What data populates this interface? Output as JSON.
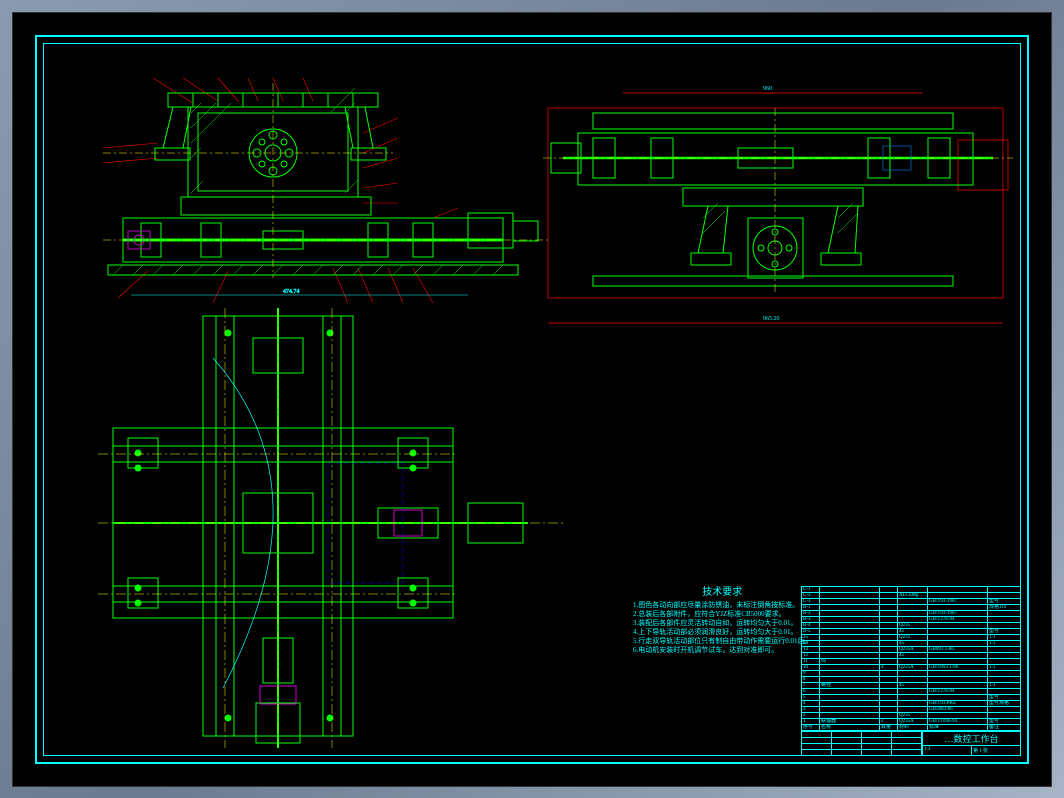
{
  "drawing": {
    "title": "…数控工作台",
    "scale": "1:2",
    "sheet": "第 1 张"
  },
  "notes": {
    "title": "技术要求",
    "lines": [
      "1.图色各动向部应尽量涂防锈油，未标注倒角按标准。",
      "2.总装后各部附件，应符合YJZ标准CB5000要求。",
      "3.装配后各部件应灵活转动自如，运转均匀大于0.01。",
      "4.上下导轨活动部必须润滑良好，运转均匀大于0.01。",
      "5.行走双导轨活动部位只有制自由带动作需要运行0.01后。",
      "6.电动机安装时开机调节试车，达到对准即可。"
    ]
  },
  "bom": {
    "header": [
      "序号",
      "名称",
      "数量",
      "材料",
      "标准",
      "备注"
    ],
    "rows": [
      [
        "C-1",
        "",
        "",
        "",
        "",
        ""
      ],
      [
        "C-2",
        "",
        "",
        "ALCuMg",
        "",
        ""
      ],
      [
        "C-3",
        "",
        "",
        "",
        "GB/T93-1987",
        "型号"
      ],
      [
        "B-1",
        "",
        "",
        "",
        "",
        "规格110"
      ],
      [
        "B-2",
        "",
        "",
        "",
        "GB/T93-1987",
        ""
      ],
      [
        "B-3",
        "",
        "",
        "",
        "GB/T276-94",
        ""
      ],
      [
        "B-4",
        "",
        "",
        "Q235",
        "",
        ""
      ],
      [
        "B-5",
        "",
        "",
        "45",
        "",
        "型号"
      ],
      [
        "15",
        "",
        "",
        "Q235",
        "",
        "1:1"
      ],
      [
        "14",
        "",
        "",
        "45",
        "",
        "1:1"
      ],
      [
        "13",
        "",
        "",
        "Q235A",
        "GB893.1-86",
        ""
      ],
      [
        "12",
        "",
        "",
        "45",
        "",
        ""
      ],
      [
        "11",
        "伺",
        "",
        "",
        "",
        ""
      ],
      [
        "10",
        "",
        "4",
        "Q235A",
        "GB/T893.1-86",
        "1:1"
      ],
      [
        "9",
        "",
        "",
        "",
        "",
        ""
      ],
      [
        "8",
        "",
        "",
        "",
        "",
        ""
      ],
      [
        "7",
        "螺栓",
        "",
        "45",
        "",
        "1:1"
      ],
      [
        "6",
        "",
        "",
        "",
        "GB/T276-94",
        ""
      ],
      [
        "5",
        "",
        "",
        "",
        "",
        "型号"
      ],
      [
        "4",
        "",
        "",
        "",
        "GB/T93.PKE",
        "型号规格"
      ],
      [
        "3",
        "",
        "",
        "",
        "GB5803-86",
        ""
      ],
      [
        "2",
        "",
        "",
        "Q235",
        "",
        ""
      ],
      [
        "1",
        "联轴器",
        "2",
        "Q235A",
        "GB/T1096-94",
        "型号"
      ]
    ]
  },
  "dimensions": {
    "top_right_width": "960",
    "bottom_span": "965.20"
  }
}
